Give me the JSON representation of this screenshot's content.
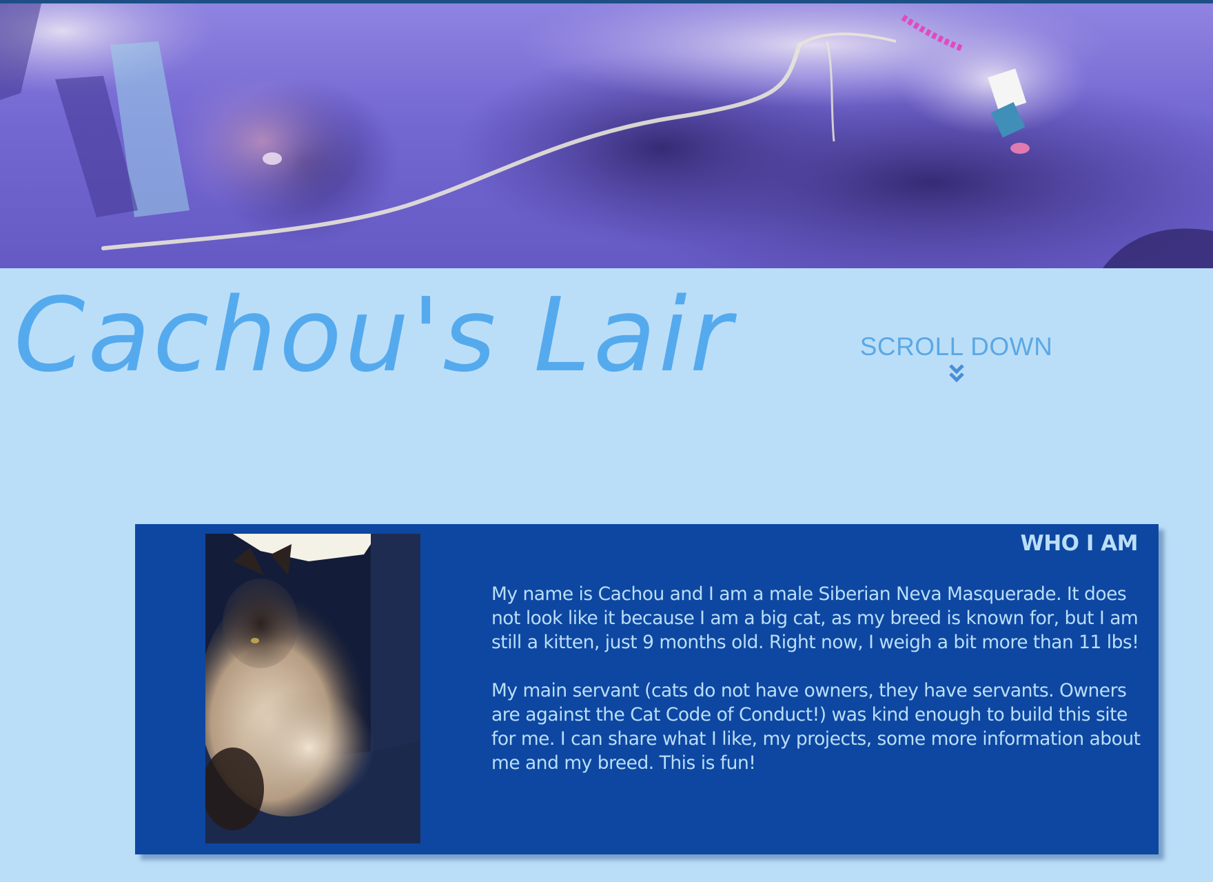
{
  "site": {
    "title": "Cachou's Lair"
  },
  "hero": {
    "image_description_icon": "cat-with-string-hero-image"
  },
  "nav": {
    "scroll_down_label": "SCROLL DOWN",
    "scroll_icon": "double-chevron-down-icon"
  },
  "about": {
    "heading": "WHO I AM",
    "photo_icon": "cat-photo",
    "paragraphs": [
      "My name is Cachou and I am a male Siberian Neva Masquerade. It does not look like it because I am a big cat, as my breed is known for, but I am still a kitten, just 9 months old. Right now, I weigh a bit more than 11 lbs!",
      "My main servant (cats do not have owners, they have servants. Owners are against the Cat Code of Conduct!) was kind enough to build this site for me. I can share what I like, my projects, some more information about me and my breed. This is fun!"
    ]
  },
  "colors": {
    "page_background": "#bbdef8",
    "title_blue": "#55aaee",
    "card_background": "#0d47a1",
    "card_text": "#bbdef8",
    "top_bar": "#1d4f86"
  }
}
